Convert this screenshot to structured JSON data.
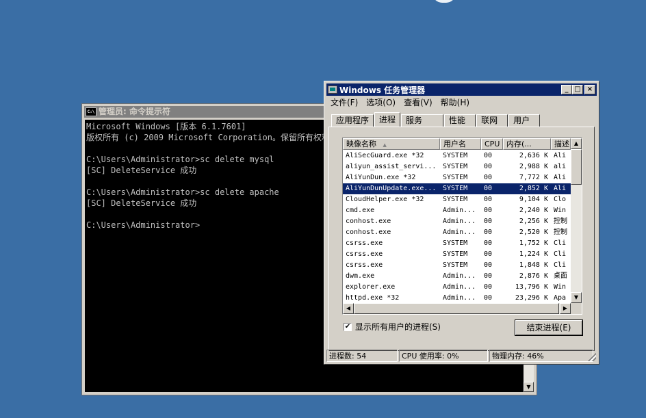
{
  "cmd": {
    "title": "管理员: 命令提示符",
    "icon_text": "C:\\",
    "lines": [
      "Microsoft Windows [版本 6.1.7601]",
      "版权所有 (c) 2009 Microsoft Corporation。保留所有权利。",
      "",
      "C:\\Users\\Administrator>sc delete mysql",
      "[SC] DeleteService 成功",
      "",
      "C:\\Users\\Administrator>sc delete apache",
      "[SC] DeleteService 成功",
      "",
      "C:\\Users\\Administrator>"
    ]
  },
  "taskmgr": {
    "title": "Windows 任务管理器",
    "title_buttons": [
      "_",
      "□",
      "×"
    ],
    "menu": [
      "文件(F)",
      "选项(O)",
      "查看(V)",
      "帮助(H)"
    ],
    "tabs": [
      "应用程序",
      "进程",
      "服务",
      "性能",
      "联网",
      "用户"
    ],
    "active_tab": "进程",
    "columns": [
      "映像名称",
      "用户名",
      "CPU",
      "内存(...",
      "描述"
    ],
    "sort_glyph": "▲",
    "rows": [
      {
        "name": "AliSecGuard.exe *32",
        "user": "SYSTEM",
        "cpu": "00",
        "mem": "2,636 K",
        "desc": "Ali"
      },
      {
        "name": "aliyun_assist_servi...",
        "user": "SYSTEM",
        "cpu": "00",
        "mem": "2,988 K",
        "desc": "ali"
      },
      {
        "name": "AliYunDun.exe *32",
        "user": "SYSTEM",
        "cpu": "00",
        "mem": "7,772 K",
        "desc": "Ali"
      },
      {
        "name": "AliYunDunUpdate.exe...",
        "user": "SYSTEM",
        "cpu": "00",
        "mem": "2,852 K",
        "desc": "Ali",
        "selected": true
      },
      {
        "name": "CloudHelper.exe *32",
        "user": "SYSTEM",
        "cpu": "00",
        "mem": "9,104 K",
        "desc": "Clo"
      },
      {
        "name": "cmd.exe",
        "user": "Admin...",
        "cpu": "00",
        "mem": "2,240 K",
        "desc": "Win"
      },
      {
        "name": "conhost.exe",
        "user": "Admin...",
        "cpu": "00",
        "mem": "2,256 K",
        "desc": "控制"
      },
      {
        "name": "conhost.exe",
        "user": "Admin...",
        "cpu": "00",
        "mem": "2,520 K",
        "desc": "控制"
      },
      {
        "name": "csrss.exe",
        "user": "SYSTEM",
        "cpu": "00",
        "mem": "1,752 K",
        "desc": "Cli"
      },
      {
        "name": "csrss.exe",
        "user": "SYSTEM",
        "cpu": "00",
        "mem": "1,224 K",
        "desc": "Cli"
      },
      {
        "name": "csrss.exe",
        "user": "SYSTEM",
        "cpu": "00",
        "mem": "1,848 K",
        "desc": "Cli"
      },
      {
        "name": "dwm.exe",
        "user": "Admin...",
        "cpu": "00",
        "mem": "2,876 K",
        "desc": "桌面"
      },
      {
        "name": "explorer.exe",
        "user": "Admin...",
        "cpu": "00",
        "mem": "13,796 K",
        "desc": "Win"
      },
      {
        "name": "httpd.exe *32",
        "user": "Admin...",
        "cpu": "00",
        "mem": "23,296 K",
        "desc": "Apa"
      }
    ],
    "show_all_users_label": "显示所有用户的进程(S)",
    "show_all_users_checked": true,
    "end_process_label": "结束进程(E)",
    "status": {
      "processes": "进程数: 54",
      "cpu": "CPU 使用率: 0%",
      "memory": "物理内存: 46%"
    }
  },
  "icons": {
    "check": "✔",
    "scroll_up": "▲",
    "scroll_down": "▼",
    "scroll_left": "◀",
    "scroll_right": "▶"
  }
}
